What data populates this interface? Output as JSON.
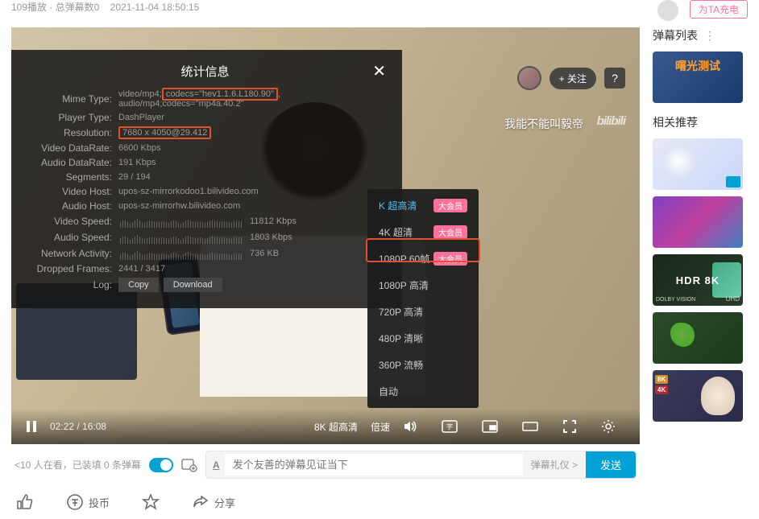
{
  "top": {
    "play_count": "109播放 · 总弹幕数0",
    "upload_time": "2021-11-04 18:50:15",
    "charge_label": "为TA充电"
  },
  "player": {
    "watermark_text": "我能不能叫毅帝",
    "watermark_logo": "bilibili",
    "follow_label": "+ 关注",
    "help_label": "?",
    "current_time": "02:22",
    "duration": "16:08",
    "quality_label": "8K 超高清",
    "speed_label": "倍速"
  },
  "stats": {
    "title": "统计信息",
    "rows": {
      "mime_label": "Mime Type:",
      "mime_pre": "video/mp4;",
      "mime_codec": "codecs=\"hev1.1.6.L180.90\"",
      "mime_post": ", audio/mp4;codecs=\"mp4a.40.2\"",
      "player_label": "Player Type:",
      "player_val": "DashPlayer",
      "res_label": "Resolution:",
      "res_val": "7680 x 4050@29.412",
      "vdr_label": "Video DataRate:",
      "vdr_val": "6600 Kbps",
      "adr_label": "Audio DataRate:",
      "adr_val": "191 Kbps",
      "seg_label": "Segments:",
      "seg_val": "29 / 194",
      "vhost_label": "Video Host:",
      "vhost_val": "upos-sz-mirrorkodoo1.bilivideo.com",
      "ahost_label": "Audio Host:",
      "ahost_val": "upos-sz-mirrorhw.bilivideo.com",
      "vspd_label": "Video Speed:",
      "vspd_val": "11812 Kbps",
      "aspd_label": "Audio Speed:",
      "aspd_val": "1803 Kbps",
      "net_label": "Network Activity:",
      "net_val": "736 KB",
      "drop_label": "Dropped Frames:",
      "drop_val": "2441 / 3417",
      "log_label": "Log:",
      "copy_btn": "Copy",
      "download_btn": "Download"
    }
  },
  "quality_menu": {
    "badge": "大会员",
    "items": [
      {
        "label": "K 超高清",
        "vip": true,
        "active": true
      },
      {
        "label": "4K 超清",
        "vip": true
      },
      {
        "label": "1080P 60帧",
        "vip": true
      },
      {
        "label": "1080P 高清"
      },
      {
        "label": "720P 高清"
      },
      {
        "label": "480P 清晰"
      },
      {
        "label": "360P 流畅"
      },
      {
        "label": "自动"
      }
    ]
  },
  "danmu": {
    "viewers": "<10 人在看，已装填 0 条弹幕",
    "placeholder": "发个友善的弹幕见证当下",
    "gift_label": "弹幕礼仪 >",
    "send_label": "发送"
  },
  "actions": {
    "like": "",
    "coin": "投币",
    "fav": "",
    "share": "分享"
  },
  "sidebar": {
    "danmu_list": "弹幕列表",
    "related": "相关推荐",
    "thumb1_text": "曙光测试",
    "thumb4_text": "HDR 8K",
    "badge_8k": "8K",
    "badge_4k": "4K"
  }
}
